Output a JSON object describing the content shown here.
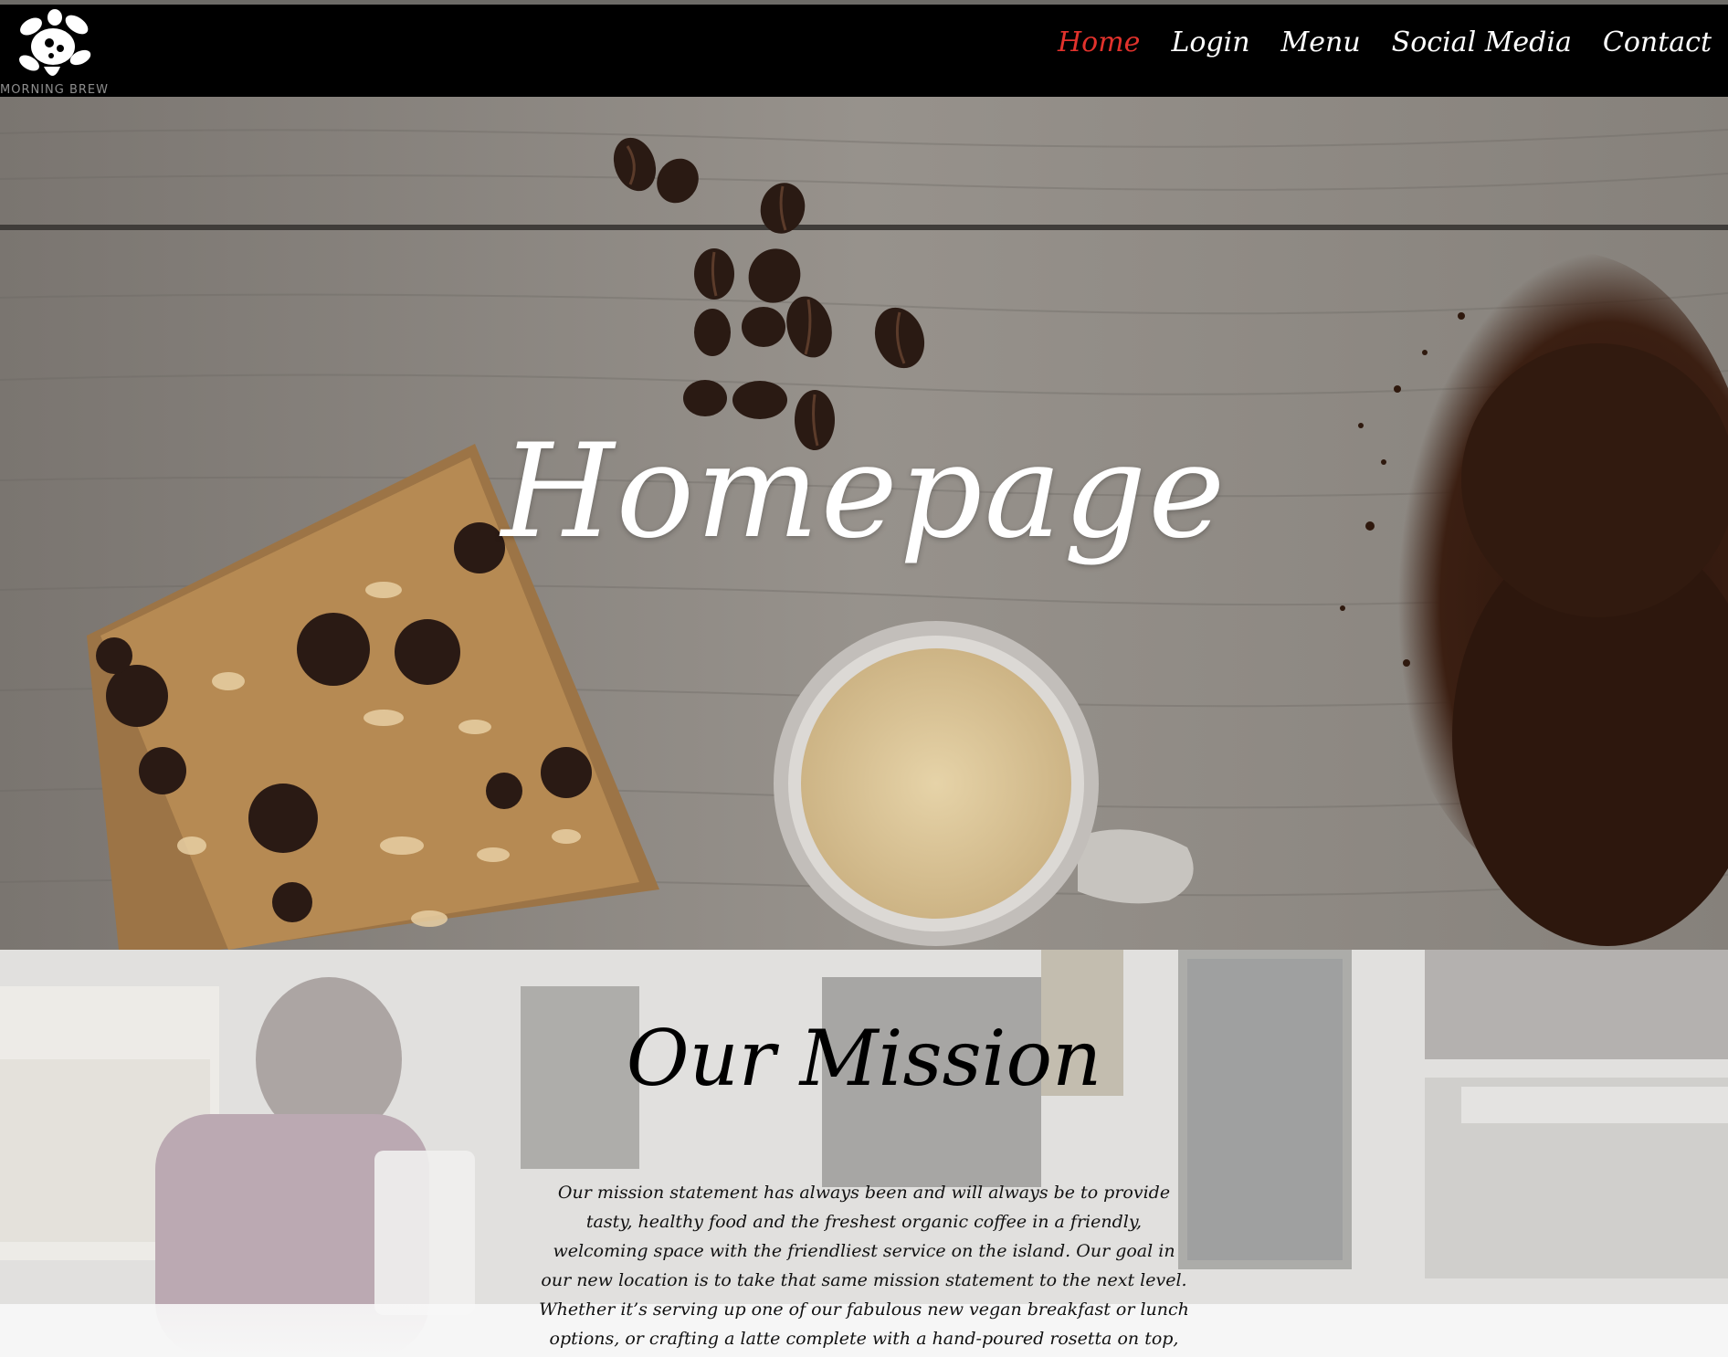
{
  "brand": {
    "name": "MORNING BREW",
    "logo_icon": "turtle-logo-icon"
  },
  "nav": {
    "items": [
      {
        "label": "Home",
        "active": true
      },
      {
        "label": "Login",
        "active": false
      },
      {
        "label": "Menu",
        "active": false
      },
      {
        "label": "Social Media",
        "active": false
      },
      {
        "label": "Contact",
        "active": false
      }
    ],
    "active_color": "#e2322c",
    "link_color": "#ffffff"
  },
  "hero": {
    "title": "Homepage"
  },
  "mission": {
    "title": "Our Mission",
    "body": "Our mission statement has always been and will always be to provide tasty, healthy food and the freshest organic coffee in a friendly, welcoming space with the friendliest service on the island. Our goal in our new location is to take that same mission statement to the next level. Whether it’s serving up one of our fabulous new vegan breakfast or lunch options, or crafting a latte complete with a hand-poured rosetta on top, we strive to always make it an exquisite experience at The Brew."
  }
}
